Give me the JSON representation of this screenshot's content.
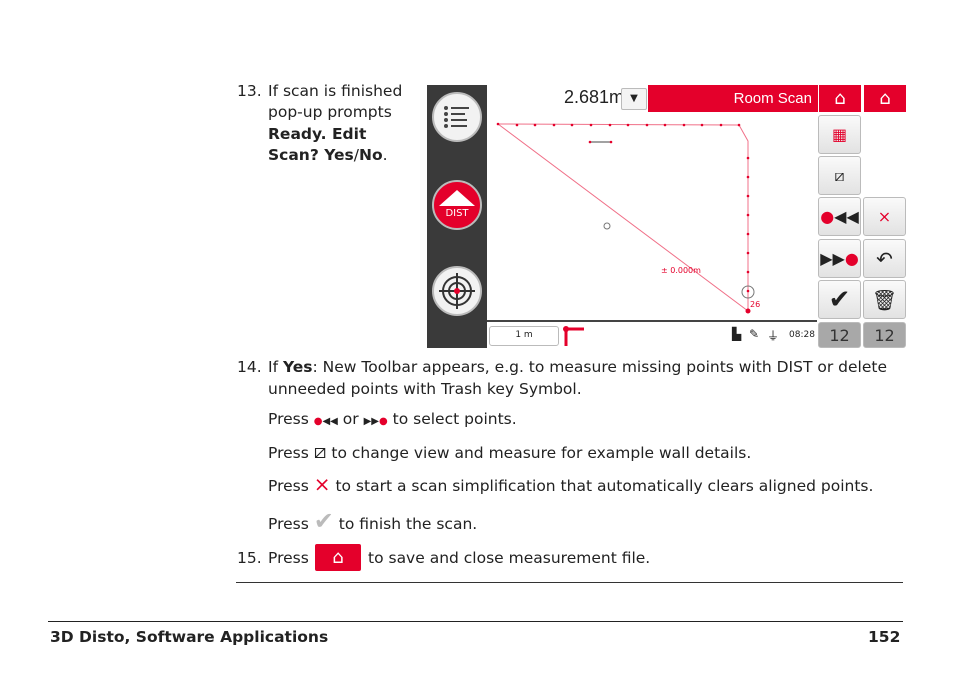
{
  "steps": {
    "s13": {
      "num": "13.",
      "line1": "If scan is finished",
      "line2": "pop-up prompts",
      "line3": "Ready. Edit",
      "line4": "Scan? Yes",
      "sep": "/",
      "no": "No",
      "end": "."
    },
    "s14": {
      "num": "14.",
      "if": "If ",
      "yes": "Yes",
      "line1": ": New Toolbar appears, e.g. to measure missing points with DIST or delete",
      "line2": "unneeded points with Trash key Symbol.",
      "press": "Press",
      "p1a": "or",
      "p1b": "to select points.",
      "p2": "to change view and measure for example wall details.",
      "p3": "to start a scan simplification that automatically clears aligned points.",
      "p4": "to finish the scan."
    },
    "s15": {
      "num": "15.",
      "press": "Press",
      "text": "to save and close measurement file."
    }
  },
  "screen": {
    "distance": "2.681m",
    "mode_title": "Room Scan",
    "dist_label": "DIST",
    "tolerance_label": "± 0.000m",
    "point_label": "26",
    "scale_label": "1 m",
    "time": "08:28",
    "page_indicator": "12",
    "accent": "#e4002b",
    "icons": [
      "menu-icon",
      "dist-icon",
      "target-icon",
      "home-icon",
      "3d-view-icon",
      "wall-view-icon",
      "previous-point-icon",
      "next-point-icon",
      "simplify-icon",
      "undo-icon",
      "check-icon",
      "trash-icon"
    ]
  },
  "footer": {
    "title": "3D Disto, Software Applications",
    "page": "152"
  }
}
